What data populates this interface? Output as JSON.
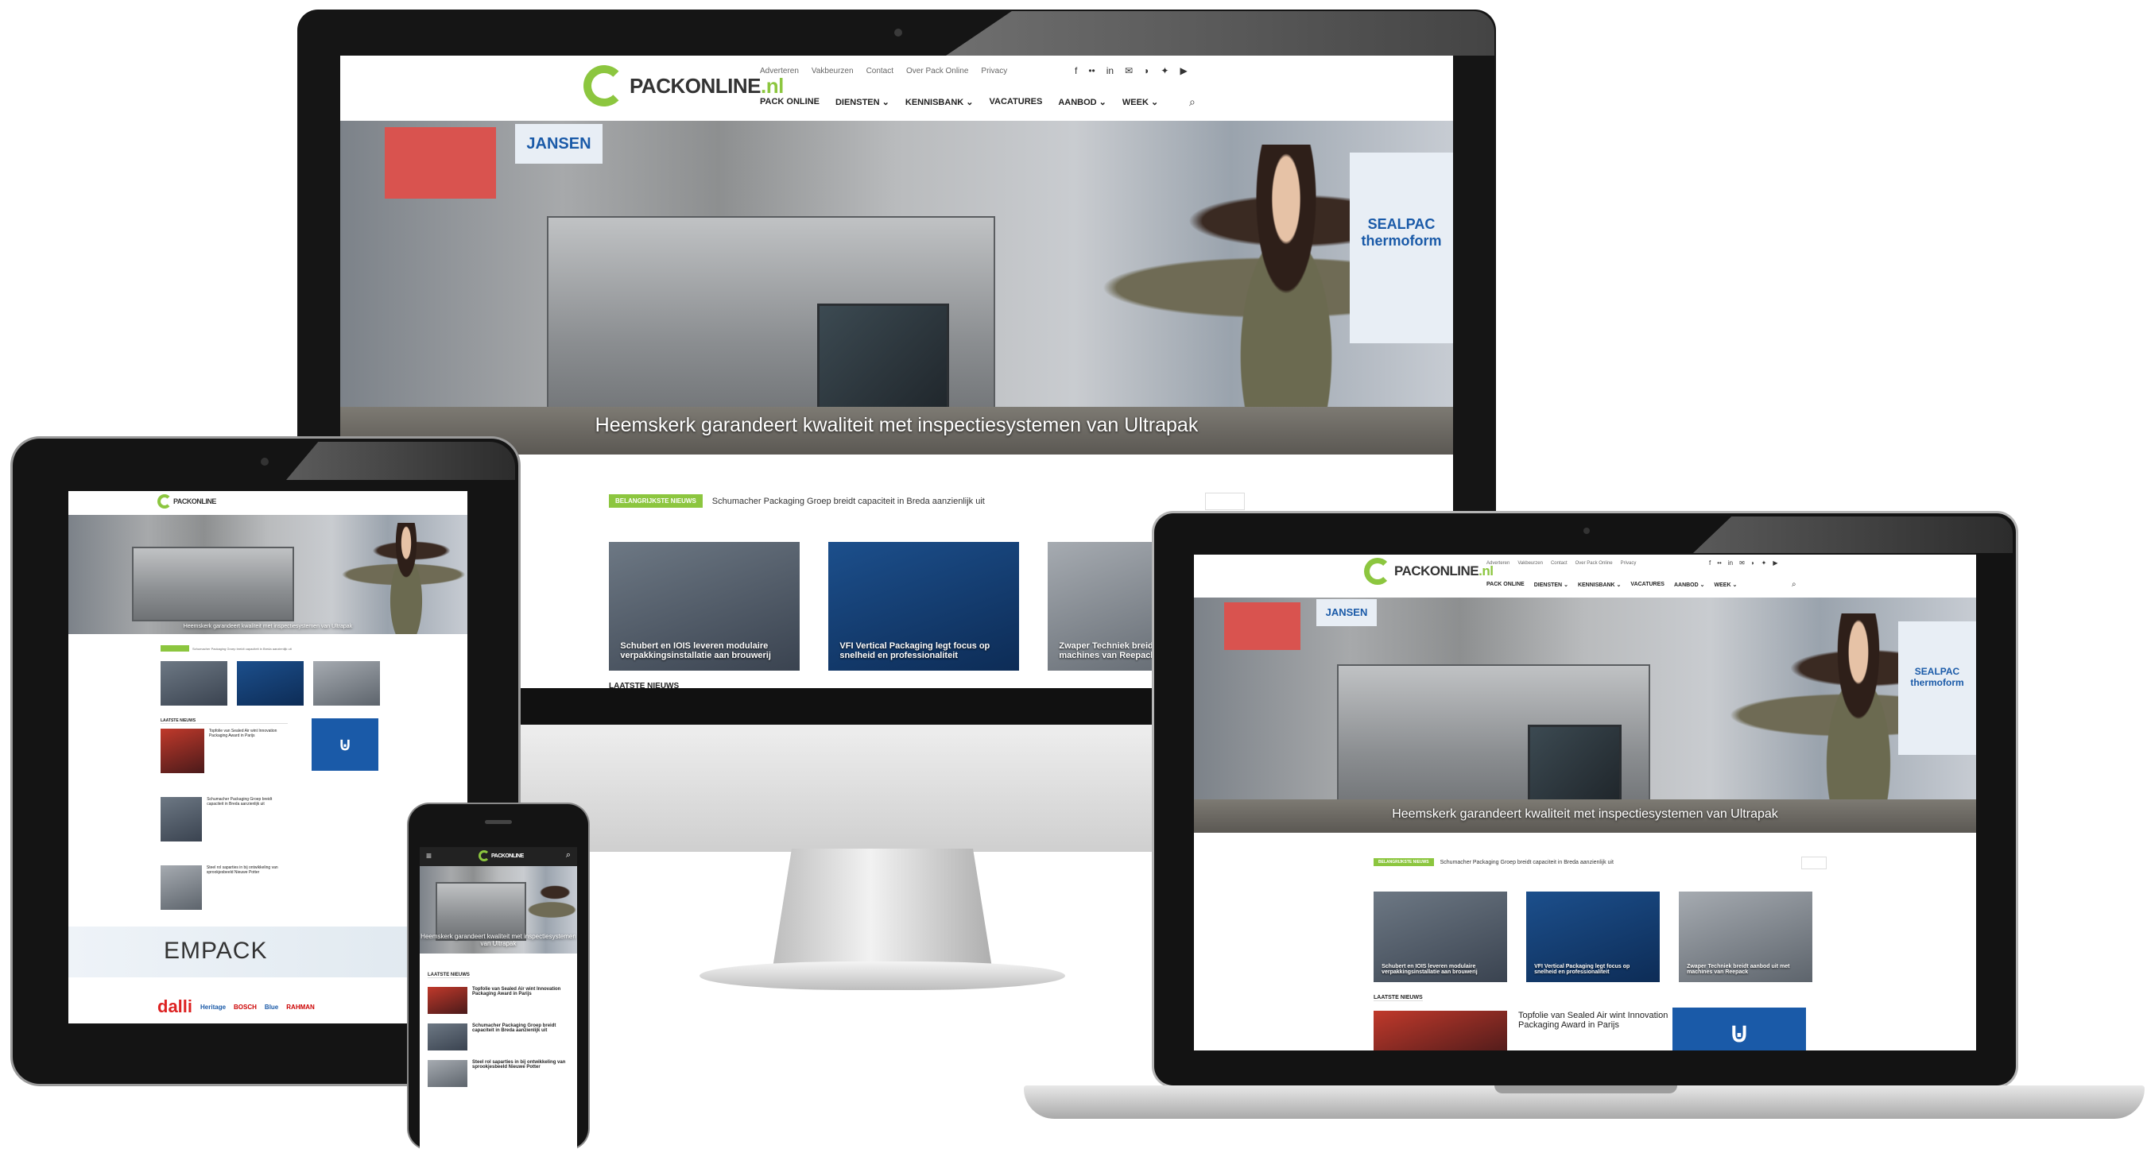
{
  "site": {
    "logo_text": "PACKONLINE",
    "logo_suffix": ".nl",
    "top_menu": [
      "Adverteren",
      "Vakbeurzen",
      "Contact",
      "Over Pack Online",
      "Privacy"
    ],
    "main_nav": [
      "PACK ONLINE",
      "DIENSTEN",
      "KENNISBANK",
      "VACATURES",
      "AANBOD",
      "WEEK"
    ],
    "hero_caption": "Heemskerk garandeert kwaliteit met inspectiesystemen van Ultrapak",
    "hero_caption_mobile": "Heemskerk garandeert kwaliteit met inspectiesystemen van Ultrapak",
    "booth_sign_left": "JANSEN",
    "booth_sign_right": "SEALPAC thermoform",
    "ticker_tag": "BELANGRIJKSTE NIEUWS",
    "ticker_text": "Schumacher Packaging Groep breidt capaciteit in Breda aanzienlijk uit",
    "cards": [
      {
        "title": "Schubert en IOIS leveren modulaire verpakkingsinstallatie aan brouwerij"
      },
      {
        "title": "VFI Vertical Packaging legt focus op snelheid en professionaliteit"
      },
      {
        "title": "Zwaper Techniek breidt aanbod uit met machines van Reepack"
      }
    ],
    "latest_news_heading": "LAATSTE NIEUWS",
    "latest_news": [
      {
        "title": "Topfolie van Sealed Air wint Innovation Packaging Award in Parijs"
      },
      {
        "title": "Schumacher Packaging Groep breidt capaciteit in Breda aanzienlijk uit"
      },
      {
        "title": "Steel rol saparties in bij ontwikkeling van sprookjesbeeld Nieuwe Potter"
      }
    ],
    "promo_brand": "EMPACK",
    "partner_logos": [
      "dalli",
      "Heritage",
      "BOSCH",
      "Blue",
      "RAHMAN"
    ]
  },
  "colors": {
    "accent_green": "#8cc63f",
    "brand_blue": "#1a5aa8",
    "device_black": "#151515",
    "silver": "#c8c8c8"
  },
  "icons": [
    "facebook-icon",
    "twitter-icon",
    "linkedin-icon",
    "rss-icon",
    "youtube-icon",
    "search-icon",
    "hamburger-menu-icon",
    "chevron-down-icon"
  ]
}
